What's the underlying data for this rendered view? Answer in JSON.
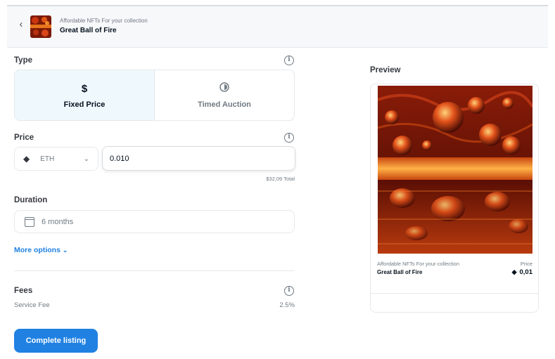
{
  "header": {
    "back_icon": "chevron-left-icon",
    "collection": "Affordable NFTs For your collection",
    "title": "Great Ball of Fire"
  },
  "type_section": {
    "label": "Type",
    "options": [
      {
        "label": "Fixed Price",
        "icon": "dollar-icon",
        "selected": true
      },
      {
        "label": "Timed Auction",
        "icon": "timer-icon",
        "selected": false
      }
    ]
  },
  "price_section": {
    "label": "Price",
    "currency": "ETH",
    "value": "0.010",
    "total": "$32,09 Total"
  },
  "duration_section": {
    "label": "Duration",
    "value": "6 months"
  },
  "more_options": "More options",
  "fees_section": {
    "label": "Fees",
    "service_fee_label": "Service Fee",
    "service_fee_value": "2.5%"
  },
  "complete_button": "Complete listing",
  "preview": {
    "label": "Preview",
    "collection": "Affordable NFTs For your collection",
    "title": "Great Ball of Fire",
    "price_label": "Price",
    "price_value": "0,01"
  },
  "colors": {
    "accent": "#2081e2",
    "selected_bg": "#eff8fd",
    "border": "#e5e8eb"
  }
}
